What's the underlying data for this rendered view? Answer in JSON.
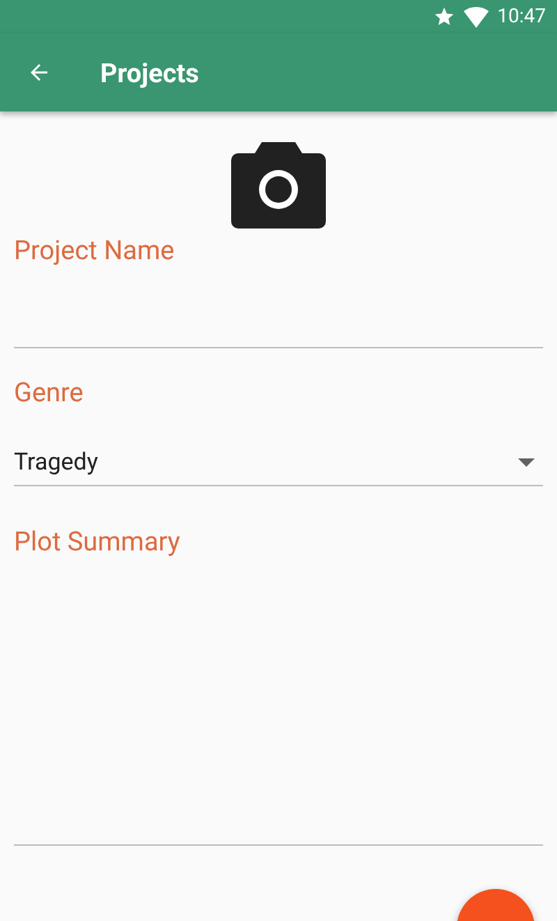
{
  "status_bar": {
    "time": "10:47"
  },
  "toolbar": {
    "title": "Projects"
  },
  "fields": [
    {
      "kind": "text",
      "label": "Project Name"
    },
    {
      "kind": "dropdown",
      "label": "Genre",
      "value": "Tragedy"
    },
    {
      "kind": "textarea",
      "label": "Plot Summary"
    }
  ]
}
